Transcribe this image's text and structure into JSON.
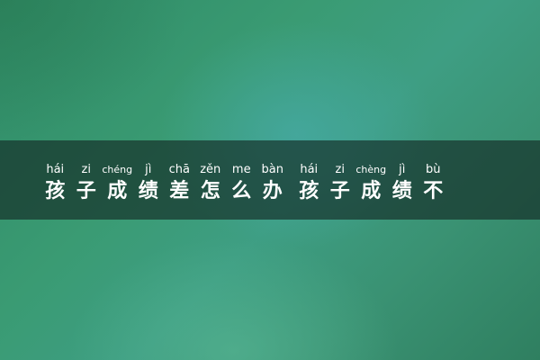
{
  "title": {
    "chars": [
      {
        "hanzi": "孩",
        "pinyin": "hái"
      },
      {
        "hanzi": "子",
        "pinyin": "zi"
      },
      {
        "hanzi": "成",
        "pinyin": "chéng"
      },
      {
        "hanzi": "绩",
        "pinyin": "jì"
      },
      {
        "hanzi": "差",
        "pinyin": "chā"
      },
      {
        "hanzi": "怎",
        "pinyin": "zěn"
      },
      {
        "hanzi": "么",
        "pinyin": "me"
      },
      {
        "hanzi": "办",
        "pinyin": "bàn"
      },
      {
        "hanzi": "孩",
        "pinyin": "hái"
      },
      {
        "hanzi": "子",
        "pinyin": "zi"
      },
      {
        "hanzi": "成",
        "pinyin": "chèng"
      },
      {
        "hanzi": "绩",
        "pinyin": "jì"
      },
      {
        "hanzi": "不",
        "pinyin": "bù"
      }
    ]
  },
  "colors": {
    "text": "#ffffff",
    "band": "#142d28",
    "background": "#3a9b73"
  }
}
